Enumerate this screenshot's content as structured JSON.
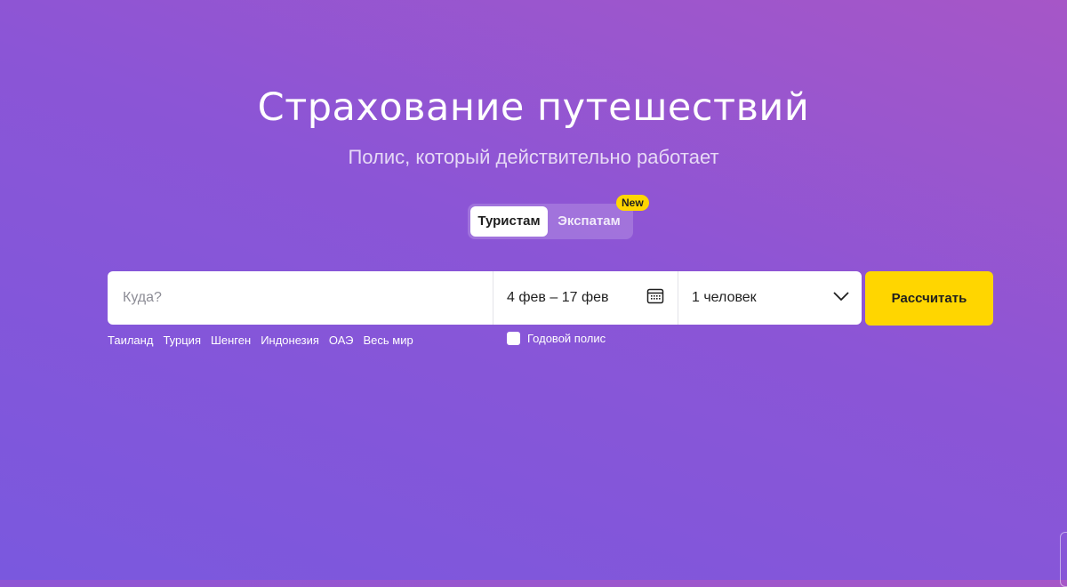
{
  "hero": {
    "title": "Страхование путешествий",
    "subtitle": "Полис, который действительно работает"
  },
  "tabs": {
    "items": [
      {
        "label": "Туристам",
        "active": true
      },
      {
        "label": "Экспатам",
        "active": false
      }
    ],
    "badge": "New"
  },
  "search": {
    "destination_placeholder": "Куда?",
    "destination_value": "",
    "dates": "4 фев – 17 фев",
    "dates_icon": "calendar-icon",
    "travelers": "1 человек",
    "travelers_icon": "chevron-down-icon",
    "submit_label": "Рассчитать"
  },
  "quick_destinations": [
    "Таиланд",
    "Турция",
    "Шенген",
    "Индонезия",
    "ОАЭ",
    "Весь мир"
  ],
  "annual_policy": {
    "label": "Годовой полис",
    "checked": false
  },
  "colors": {
    "accent": "#ffd600",
    "background_start": "#7a58de",
    "background_end": "#a656c7"
  }
}
